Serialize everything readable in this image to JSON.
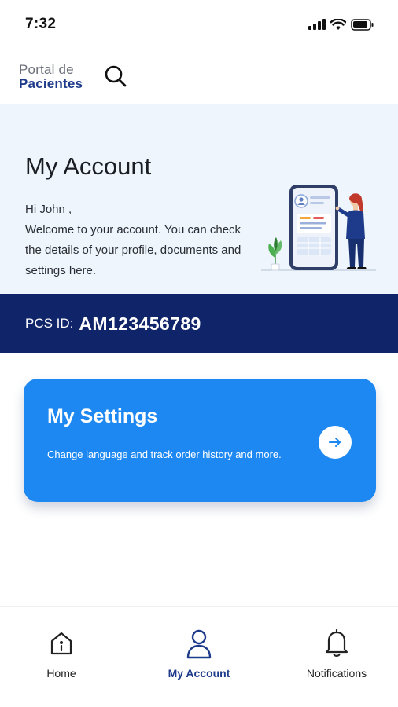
{
  "status_bar": {
    "time": "7:32"
  },
  "header": {
    "logo_line1": "Portal de",
    "logo_line2": "Pacientes"
  },
  "hero": {
    "title": "My Account",
    "greeting": "Hi John ,",
    "message": "Welcome to your account. You can check the details of your profile, documents and settings here."
  },
  "pcs": {
    "label": "PCS ID:",
    "value": "AM123456789"
  },
  "settings_card": {
    "title": "My Settings",
    "description": "Change language and track order history and more."
  },
  "bottom_nav": {
    "items": [
      {
        "label": "Home",
        "icon": "home-icon",
        "active": false
      },
      {
        "label": "My Account",
        "icon": "user-icon",
        "active": true
      },
      {
        "label": "Notifications",
        "icon": "bell-icon",
        "active": false
      }
    ]
  },
  "colors": {
    "brand_navy": "#0f2469",
    "card_blue": "#1e88f2",
    "hero_bg": "#eef5fc",
    "active_nav": "#1e3a8a"
  }
}
